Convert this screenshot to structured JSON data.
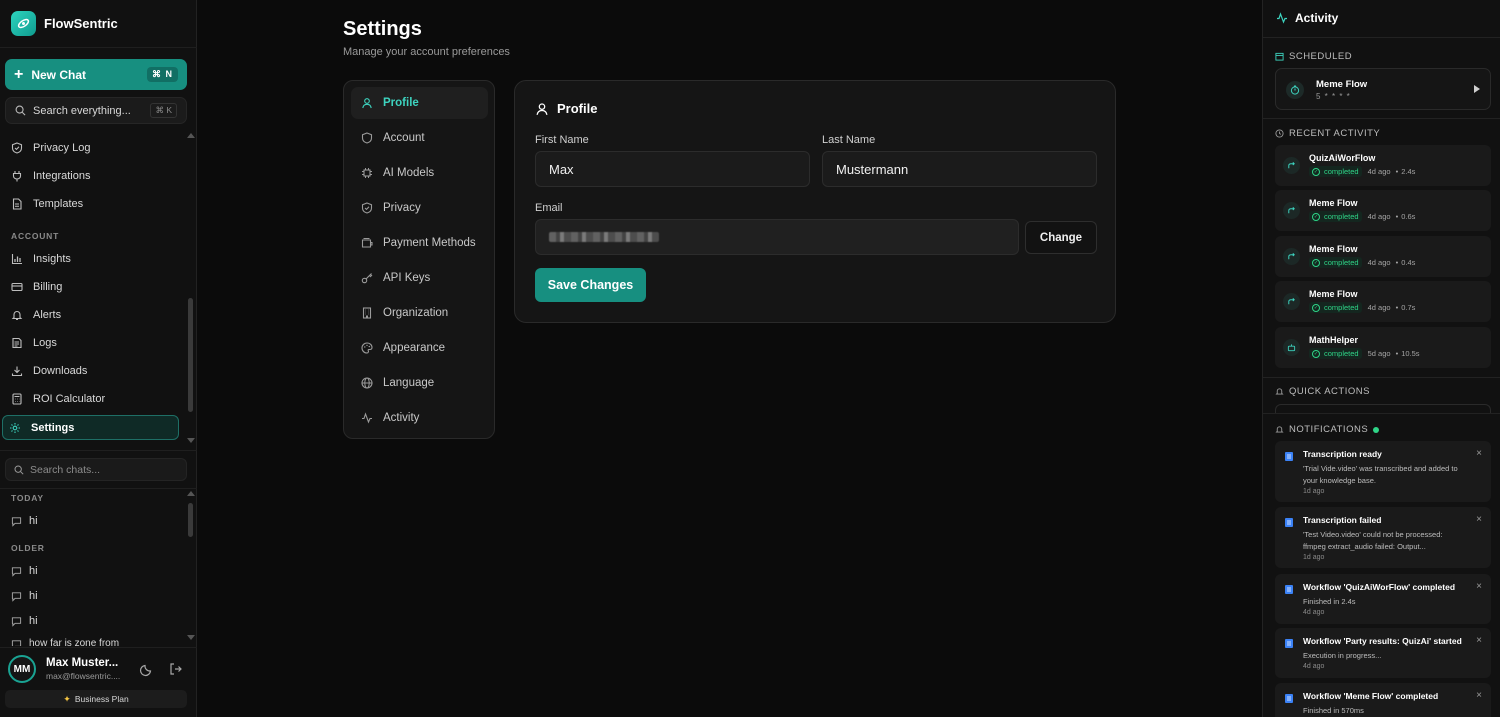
{
  "brand": {
    "name": "FlowSentric"
  },
  "sidebar": {
    "new_chat": {
      "label": "New Chat",
      "shortcut": "⌘ N"
    },
    "search": {
      "placeholder": "Search everything...",
      "shortcut": "⌘ K"
    },
    "nav_items": [
      {
        "label": "Privacy Log",
        "icon": "shield-icon"
      },
      {
        "label": "Integrations",
        "icon": "plug-icon"
      },
      {
        "label": "Templates",
        "icon": "file-icon"
      }
    ],
    "account_section": "ACCOUNT",
    "account_items": [
      {
        "label": "Insights",
        "icon": "bar-chart-icon"
      },
      {
        "label": "Billing",
        "icon": "credit-card-icon"
      },
      {
        "label": "Alerts",
        "icon": "bell-icon"
      },
      {
        "label": "Logs",
        "icon": "logs-icon"
      },
      {
        "label": "Downloads",
        "icon": "download-icon"
      },
      {
        "label": "ROI Calculator",
        "icon": "calculator-icon"
      },
      {
        "label": "Settings",
        "icon": "gear-icon",
        "active": true
      }
    ],
    "search_chats": {
      "placeholder": "Search chats..."
    },
    "today_section": "TODAY",
    "today_chats": [
      "hi"
    ],
    "older_section": "OLDER",
    "older_chats": [
      "hi",
      "hi",
      "hi",
      "how far is zone from"
    ],
    "user": {
      "initials": "MM",
      "name": "Max Muster...",
      "email": "max@flowsentric...."
    },
    "plan": "Business Plan"
  },
  "main": {
    "title": "Settings",
    "subtitle": "Manage your account preferences",
    "settings_nav": [
      {
        "label": "Profile",
        "icon": "user-icon",
        "active": true
      },
      {
        "label": "Account",
        "icon": "shield-icon"
      },
      {
        "label": "AI Models",
        "icon": "cpu-icon"
      },
      {
        "label": "Privacy",
        "icon": "shield-check-icon"
      },
      {
        "label": "Payment Methods",
        "icon": "wallet-icon"
      },
      {
        "label": "API Keys",
        "icon": "key-icon"
      },
      {
        "label": "Organization",
        "icon": "building-icon"
      },
      {
        "label": "Appearance",
        "icon": "palette-icon"
      },
      {
        "label": "Language",
        "icon": "globe-icon"
      },
      {
        "label": "Activity",
        "icon": "activity-icon"
      }
    ],
    "profile": {
      "title": "Profile",
      "first_name_label": "First Name",
      "first_name_value": "Max",
      "last_name_label": "Last Name",
      "last_name_value": "Mustermann",
      "email_label": "Email",
      "change_label": "Change",
      "save_label": "Save Changes"
    }
  },
  "right_panel": {
    "title": "Activity",
    "scheduled_label": "SCHEDULED",
    "scheduled": [
      {
        "name": "Meme Flow",
        "cron": "5 * * * *"
      }
    ],
    "recent_label": "RECENT ACTIVITY",
    "recent": [
      {
        "name": "QuizAiWorFlow",
        "status": "completed",
        "ago": "4d ago",
        "duration": "2.4s"
      },
      {
        "name": "Meme Flow",
        "status": "completed",
        "ago": "4d ago",
        "duration": "0.6s"
      },
      {
        "name": "Meme Flow",
        "status": "completed",
        "ago": "4d ago",
        "duration": "0.4s"
      },
      {
        "name": "Meme Flow",
        "status": "completed",
        "ago": "4d ago",
        "duration": "0.7s"
      },
      {
        "name": "MathHelper",
        "status": "completed",
        "ago": "5d ago",
        "duration": "10.5s"
      }
    ],
    "quick_actions_label": "QUICK ACTIONS",
    "notifications_label": "NOTIFICATIONS",
    "notifications": [
      {
        "title": "Transcription ready",
        "body": "'Trial Vide.video' was transcribed and added to your knowledge base.",
        "time": "1d ago"
      },
      {
        "title": "Transcription failed",
        "body": "'Test Video.video' could not be processed: ffmpeg extract_audio failed: Output...",
        "time": "1d ago"
      },
      {
        "title": "Workflow 'QuizAiWorFlow' completed",
        "body": "Finished in 2.4s",
        "time": "4d ago"
      },
      {
        "title": "Workflow 'Party results: QuizAi' started",
        "body": "Execution in progress...",
        "time": "4d ago"
      },
      {
        "title": "Workflow 'Meme Flow' completed",
        "body": "Finished in 570ms",
        "time": ""
      }
    ]
  },
  "colors": {
    "accent": "#178f80",
    "accent_text": "#3dd3bf",
    "success": "#2fd487",
    "background": "#0b0b0b"
  }
}
